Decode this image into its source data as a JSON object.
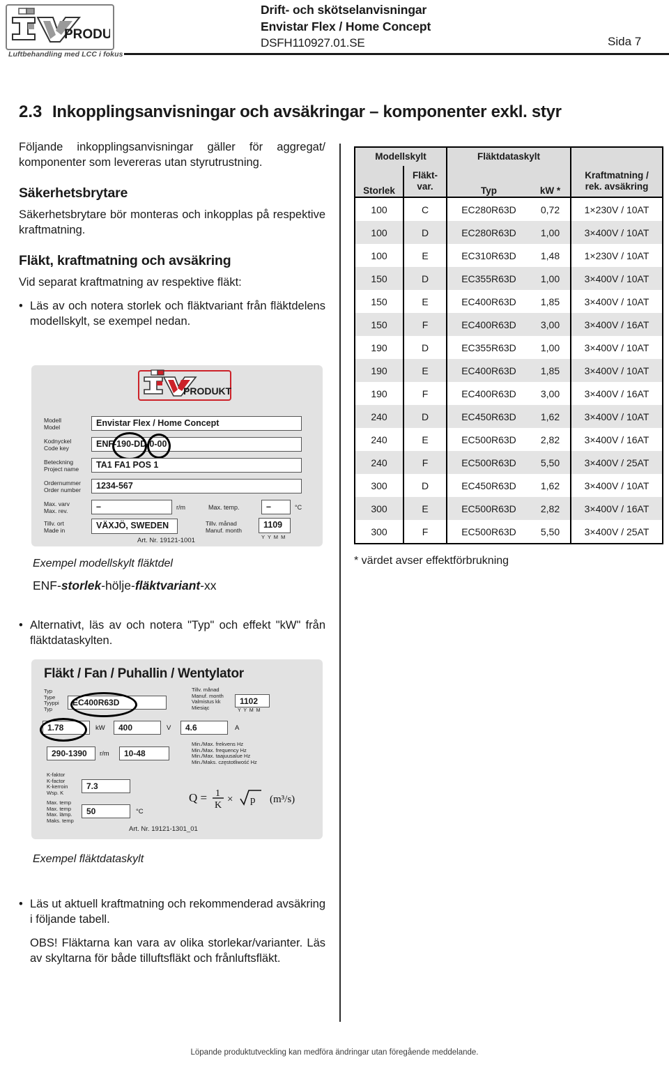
{
  "header": {
    "logo_text": "PRODUKT",
    "logo_mark": "iv-produkt-logo",
    "tagline": "Luftbehandling med LCC i fokus",
    "title_line1": "Drift- och skötselanvisningar",
    "title_line2": "Envistar Flex / Home Concept",
    "doc_id": "DSFH110927.01.SE",
    "page_label": "Sida 7"
  },
  "section": {
    "number": "2.3",
    "title": "Inkopplingsanvisningar och avsäkringar – komponenter exkl. styr"
  },
  "left": {
    "intro": "Följande inkopplingsanvisningar gäller för aggregat/ komponenter som levereras utan styrutrustning.",
    "heading_safety": "Säkerhetsbrytare",
    "safety_text": "Säkerhetsbrytare bör monteras och inkopplas på respektive kraftmatning.",
    "heading_fan": "Fläkt, kraftmatning och avsäkring",
    "fan_text": "Vid separat kraftmatning av respektive fläkt:",
    "bullet1": "Läs av och notera storlek och fläktvariant från fläktdelens modellskylt, se exempel nedan.",
    "caption_model": "Exempel modellskylt fläktdel",
    "codekey_parts": {
      "p1": "ENF-",
      "p2": "storlek",
      "p3": "-hölje-",
      "p4": "fläktvariant",
      "p5": "-xx"
    },
    "bullet2": "Alternativt, läs av och notera \"Typ\" och effekt \"kW\" från fläktdataskylten.",
    "caption_fan": "Exempel fläktdataskylt",
    "bullet3": "Läs ut aktuell kraftmatning och rekommenderad avsäkring i följande tabell.",
    "note_obs": "OBS! Fläktarna kan vara av olika storlekar/varianter. Läs av skyltarna för både tilluftsfläkt och frånluftsfläkt."
  },
  "model_label": {
    "logo_text": "PRODUKT",
    "rows": [
      {
        "lbl_sv": "Modell",
        "lbl_en": "Model",
        "value": "Envistar Flex / Home Concept"
      },
      {
        "lbl_sv": "Kodnyckel",
        "lbl_en": "Code key",
        "value": "ENF-190-DD-0-00"
      },
      {
        "lbl_sv": "Beteckning",
        "lbl_en": "Project name",
        "value": "TA1 FA1 POS 1"
      },
      {
        "lbl_sv": "Ordernummer",
        "lbl_en": "Order number",
        "value": "1234-567"
      }
    ],
    "max_rev_sv": "Max. varv",
    "max_rev_en": "Max. rev.",
    "max_rev_value": "–",
    "max_rev_unit": "r/m",
    "max_temp_label": "Max. temp.",
    "max_temp_value": "–",
    "max_temp_unit": "°C",
    "made_in_sv": "Tillv. ort",
    "made_in_en": "Made in",
    "made_in_value": "VÄXJÖ, SWEDEN",
    "month_sv": "Tillv. månad",
    "month_en": "Manuf. month",
    "month_value": "1109",
    "month_format": "Y Y M M",
    "art_nr": "Art. Nr. 19121-1001"
  },
  "fan_label": {
    "title": "Fläkt / Fan / Puhallin / Wentylator",
    "type_labels": [
      "Typ",
      "Type",
      "Tyyppi",
      "Typ"
    ],
    "type_value": "EC400R63D",
    "month_labels": [
      "Tillv. månad",
      "Manuf. month",
      "Valmistus kk",
      "Miesiąc"
    ],
    "month_value": "1102",
    "month_format": "Y Y M M",
    "power_value": "1.78",
    "power_unit": "kW",
    "voltage_value": "400",
    "voltage_unit": "V",
    "current_value": "4.6",
    "current_unit": "A",
    "rpm_value": "290-1390",
    "rpm_unit": "r/m",
    "freq_value": "10-48",
    "freq_labels": [
      "Min./Max. frekvens Hz",
      "Min./Max. frequency Hz",
      "Min./Max. taajuusalue Hz",
      "Min./Maks. częstotliwość Hz"
    ],
    "kfactor_labels": [
      "K-faktor",
      "K-factor",
      "K-kerroin",
      "Wsp. K"
    ],
    "kfactor_value": "7.3",
    "maxtemp_labels": [
      "Max. temp",
      "Max. temp",
      "Max. lämp.",
      "Maks. temp"
    ],
    "maxtemp_value": "50",
    "maxtemp_unit": "°C",
    "formula": "Q =  1/K × √p   (m³/s)",
    "art_nr": "Art. Nr. 19121-1301_01"
  },
  "table": {
    "group_headers": [
      "Modellskylt",
      "Fläktdataskylt",
      ""
    ],
    "columns": [
      "Storlek",
      "Fläkt-var.",
      "Typ",
      "kW *",
      "Kraftmatning / rek. avsäkring"
    ],
    "col_storlek": "Storlek",
    "col_flaktvar_l1": "Fläkt-",
    "col_flaktvar_l2": "var.",
    "col_typ": "Typ",
    "col_kw": "kW *",
    "col_kraft_l1": "Kraftmatning /",
    "col_kraft_l2": "rek. avsäkring",
    "rows": [
      {
        "storlek": "100",
        "variant": "C",
        "typ": "EC280R63D",
        "kw": "0,72",
        "power": "1×230V / 10AT"
      },
      {
        "storlek": "100",
        "variant": "D",
        "typ": "EC280R63D",
        "kw": "1,00",
        "power": "3×400V / 10AT"
      },
      {
        "storlek": "100",
        "variant": "E",
        "typ": "EC310R63D",
        "kw": "1,48",
        "power": "1×230V / 10AT"
      },
      {
        "storlek": "150",
        "variant": "D",
        "typ": "EC355R63D",
        "kw": "1,00",
        "power": "3×400V / 10AT"
      },
      {
        "storlek": "150",
        "variant": "E",
        "typ": "EC400R63D",
        "kw": "1,85",
        "power": "3×400V / 10AT"
      },
      {
        "storlek": "150",
        "variant": "F",
        "typ": "EC400R63D",
        "kw": "3,00",
        "power": "3×400V / 16AT"
      },
      {
        "storlek": "190",
        "variant": "D",
        "typ": "EC355R63D",
        "kw": "1,00",
        "power": "3×400V / 10AT"
      },
      {
        "storlek": "190",
        "variant": "E",
        "typ": "EC400R63D",
        "kw": "1,85",
        "power": "3×400V / 10AT"
      },
      {
        "storlek": "190",
        "variant": "F",
        "typ": "EC400R63D",
        "kw": "3,00",
        "power": "3×400V / 16AT"
      },
      {
        "storlek": "240",
        "variant": "D",
        "typ": "EC450R63D",
        "kw": "1,62",
        "power": "3×400V / 10AT"
      },
      {
        "storlek": "240",
        "variant": "E",
        "typ": "EC500R63D",
        "kw": "2,82",
        "power": "3×400V / 16AT"
      },
      {
        "storlek": "240",
        "variant": "F",
        "typ": "EC500R63D",
        "kw": "5,50",
        "power": "3×400V / 25AT"
      },
      {
        "storlek": "300",
        "variant": "D",
        "typ": "EC450R63D",
        "kw": "1,62",
        "power": "3×400V / 10AT"
      },
      {
        "storlek": "300",
        "variant": "E",
        "typ": "EC500R63D",
        "kw": "2,82",
        "power": "3×400V / 16AT"
      },
      {
        "storlek": "300",
        "variant": "F",
        "typ": "EC500R63D",
        "kw": "5,50",
        "power": "3×400V / 25AT"
      }
    ],
    "footnote": "* värdet avser effektförbrukning"
  },
  "footer": {
    "text": "Löpande produktutveckling kan medföra ändringar utan föregående meddelande."
  },
  "colors": {
    "brand_red": "#cc2229",
    "logo_gray": "#808080",
    "table_header_bg": "#dcdcdc",
    "table_alt_row_bg": "#e4e4e4",
    "label_bg": "#e2e2e2",
    "rule": "#1a1a1a"
  }
}
